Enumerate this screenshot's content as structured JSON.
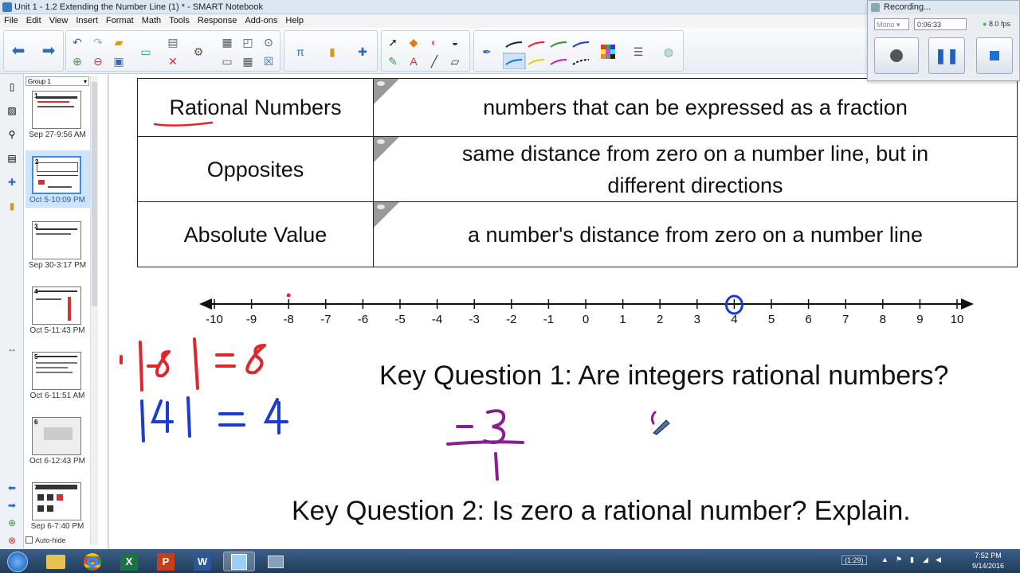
{
  "window": {
    "title": "Unit 1 - 1.2 Extending the Number Line (1) * - SMART Notebook"
  },
  "menu": [
    "File",
    "Edit",
    "View",
    "Insert",
    "Format",
    "Math",
    "Tools",
    "Response",
    "Add-ons",
    "Help"
  ],
  "recorder": {
    "title": "Recording...",
    "source_label": "Mono",
    "elapsed": "0:06:33",
    "fps": "8.0 fps"
  },
  "thumbnails": {
    "group_select": "Group 1",
    "pages": [
      {
        "num": "1",
        "label": "Sep 27-9:56 AM",
        "selected": false
      },
      {
        "num": "2",
        "label": "Oct 5-10:09 PM",
        "selected": true
      },
      {
        "num": "3",
        "label": "Sep 30-3:17 PM",
        "selected": false
      },
      {
        "num": "4",
        "label": "Oct 5-11:43 PM",
        "selected": false
      },
      {
        "num": "5",
        "label": "Oct 6-11:51 AM",
        "selected": false
      },
      {
        "num": "6",
        "label": "Oct 6-12:43 PM",
        "selected": false
      },
      {
        "num": "7",
        "label": "Sep 6-7:40 PM",
        "selected": false
      }
    ],
    "autohide_label": "Auto-hide"
  },
  "vocab_table": [
    {
      "term": "Rational Numbers",
      "definition": "numbers that can be expressed as a fraction"
    },
    {
      "term": "Opposites",
      "definition": "same distance from zero on a number line, but in different directions"
    },
    {
      "term": "Absolute Value",
      "definition": "a number's distance from zero on a number line"
    }
  ],
  "number_line": {
    "ticks": [
      "-10",
      "-9",
      "-8",
      "-7",
      "-6",
      "-5",
      "-4",
      "-3",
      "-2",
      "-1",
      "0",
      "1",
      "2",
      "3",
      "4",
      "5",
      "6",
      "7",
      "8",
      "9",
      "10"
    ],
    "marked_dot": -8,
    "circled": 4,
    "dot_color": "#e0262b",
    "circle_color": "#1a3ccf"
  },
  "handwriting": {
    "line1": "|-8| = 8",
    "line2": "|4| = 4",
    "fraction_num": "-3",
    "fraction_den": "1",
    "red": "#e0262b",
    "blue": "#1a3ccf",
    "purple": "#8a1c94"
  },
  "questions": {
    "q1": "Key Question 1:  Are integers rational numbers?",
    "q2": "Key Question 2:  Is zero a rational number?  Explain."
  },
  "taskbar": {
    "battery": "(1:29)",
    "time": "7:52 PM",
    "date": "9/14/2016"
  }
}
